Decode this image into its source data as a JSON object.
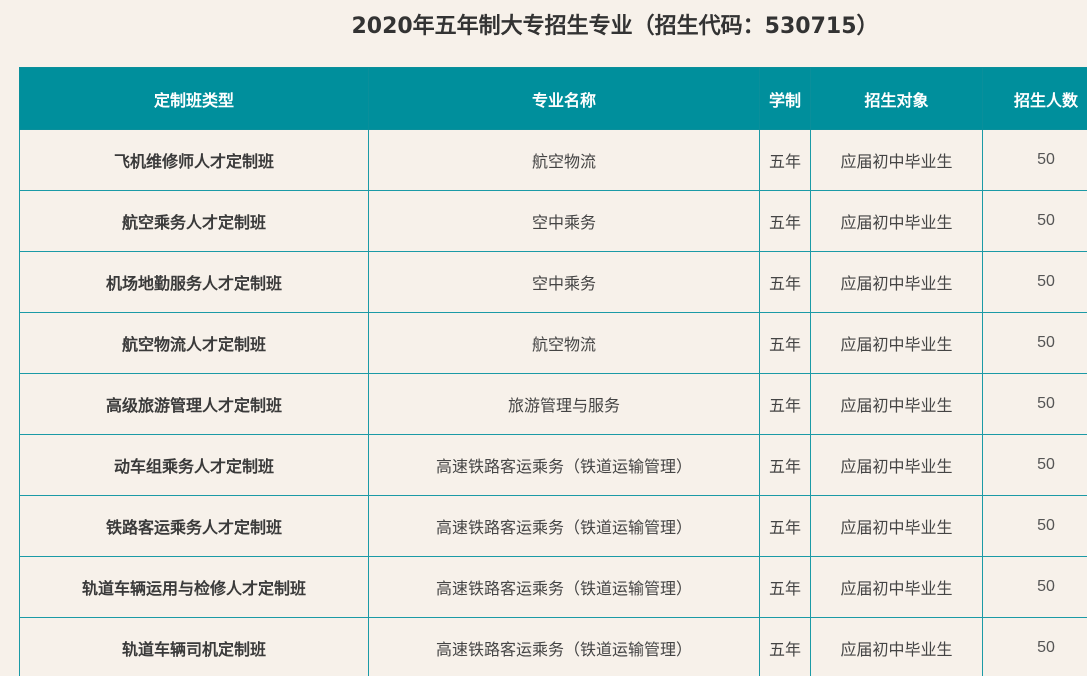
{
  "title": "2020年五年制大专招生专业（招生代码：530715）",
  "table": {
    "headers": [
      "定制班类型",
      "专业名称",
      "学制",
      "招生对象",
      "招生人数"
    ],
    "rows": [
      [
        "飞机维修师人才定制班",
        "航空物流",
        "五年",
        "应届初中毕业生",
        "50"
      ],
      [
        "航空乘务人才定制班",
        "空中乘务",
        "五年",
        "应届初中毕业生",
        "50"
      ],
      [
        "机场地勤服务人才定制班",
        "空中乘务",
        "五年",
        "应届初中毕业生",
        "50"
      ],
      [
        "航空物流人才定制班",
        "航空物流",
        "五年",
        "应届初中毕业生",
        "50"
      ],
      [
        "高级旅游管理人才定制班",
        "旅游管理与服务",
        "五年",
        "应届初中毕业生",
        "50"
      ],
      [
        "动车组乘务人才定制班",
        "高速铁路客运乘务（铁道运输管理）",
        "五年",
        "应届初中毕业生",
        "50"
      ],
      [
        "铁路客运乘务人才定制班",
        "高速铁路客运乘务（铁道运输管理）",
        "五年",
        "应届初中毕业生",
        "50"
      ],
      [
        "轨道车辆运用与检修人才定制班",
        "高速铁路客运乘务（铁道运输管理）",
        "五年",
        "应届初中毕业生",
        "50"
      ],
      [
        "轨道车辆司机定制班",
        "高速铁路客运乘务（铁道运输管理）",
        "五年",
        "应届初中毕业生",
        "50"
      ]
    ]
  },
  "colors": {
    "header_bg": "#008f9c",
    "border": "#1b9aa6",
    "page_bg": "#f7f1ea"
  }
}
